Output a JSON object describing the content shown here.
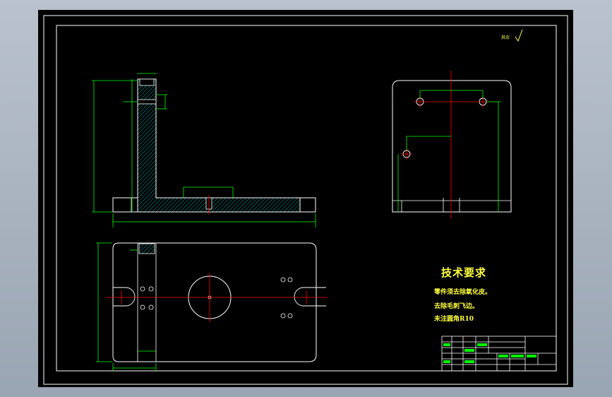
{
  "drawing": {
    "roughness_mark": "其余",
    "technical_requirements": {
      "title": "技术要求",
      "lines": [
        "零件须去除氧化皮。",
        "去除毛刺飞边。",
        "未注圆角R10"
      ]
    }
  },
  "colors": {
    "background": "#000000",
    "outline": "#ffffff",
    "dimension": "#00ff00",
    "centerline": "#ff0000",
    "hatch": "#00a8a8",
    "text": "#ffff40"
  }
}
